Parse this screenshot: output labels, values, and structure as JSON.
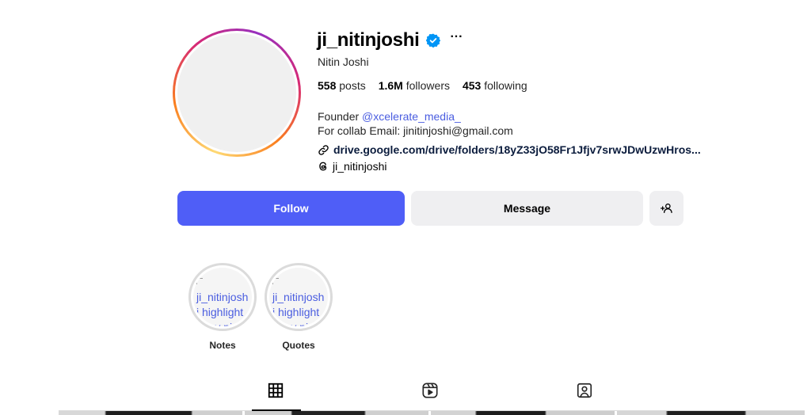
{
  "profile": {
    "username": "ji_nitinjoshi",
    "verified": true,
    "full_name": "Nitin Joshi",
    "stats": {
      "posts_count": "558",
      "posts_label": "posts",
      "followers_count": "1.6M",
      "followers_label": "followers",
      "following_count": "453",
      "following_label": "following"
    },
    "bio": {
      "line1_prefix": "Founder ",
      "line1_mention": "@xcelerate_media_",
      "line2": "For collab Email: jinitinjoshi@gmail.com"
    },
    "link": "drive.google.com/drive/folders/18yZ33jO58Fr1Jfjv7srwJDwUzwHros...",
    "threads_handle": "ji_nitinjoshi"
  },
  "actions": {
    "follow_label": "Follow",
    "message_label": "Message",
    "more_label": "···",
    "add_user_icon": "add-user-icon"
  },
  "highlights": [
    {
      "alt_text": "ji_nitinjoshi highlight story picture",
      "label": "Notes"
    },
    {
      "alt_text": "ji_nitinjoshi highlight story picture",
      "label": "Quotes"
    }
  ],
  "tabs": [
    {
      "icon": "grid-icon",
      "active": true
    },
    {
      "icon": "reels-icon",
      "active": false
    },
    {
      "icon": "tagged-icon",
      "active": false
    }
  ],
  "colors": {
    "follow_button": "#4f5ef7",
    "secondary_button": "#efeff1",
    "verified_badge": "#0095f6",
    "mention": "#4a5de0"
  }
}
